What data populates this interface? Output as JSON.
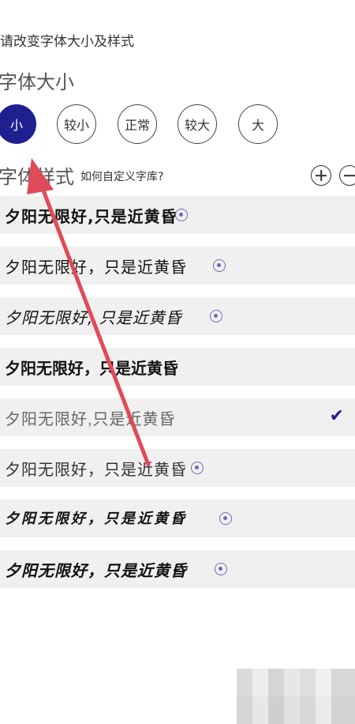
{
  "hint": "请改变字体大小及样式",
  "size_section": {
    "title": "字体大小",
    "options": [
      {
        "label": "小",
        "active": true
      },
      {
        "label": "较小",
        "active": false
      },
      {
        "label": "正常",
        "active": false
      },
      {
        "label": "较大",
        "active": false
      },
      {
        "label": "大",
        "active": false
      }
    ]
  },
  "style_section": {
    "title": "字体样式",
    "help_link": "如何自定义字库?",
    "add_icon": "plus-circle-icon",
    "remove_icon": "minus-circle-icon"
  },
  "fonts": [
    {
      "sample": "夕阳无限好,只是近黄昏",
      "download_icon": true,
      "selected": false
    },
    {
      "sample": "夕阳无限好，只是近黄昏",
      "download_icon": true,
      "selected": false
    },
    {
      "sample": "夕阳无限好, 只是近黄昏",
      "download_icon": true,
      "selected": false
    },
    {
      "sample": "夕阳无限好，只是近黄昏",
      "download_icon": false,
      "selected": false
    },
    {
      "sample": "夕阳无限好,只是近黄昏",
      "download_icon": false,
      "selected": true
    },
    {
      "sample": "夕阳无限好，只是近黄昏",
      "download_icon": true,
      "selected": false
    },
    {
      "sample": "夕阳无限好，只是近黄昏",
      "download_icon": true,
      "selected": false
    },
    {
      "sample": "夕阳无限好，只是近黄昏",
      "download_icon": true,
      "selected": false
    }
  ],
  "colors": {
    "accent": "#1f2090",
    "row_bg": "#f0f0f0",
    "arrow": "#e04a5a"
  }
}
